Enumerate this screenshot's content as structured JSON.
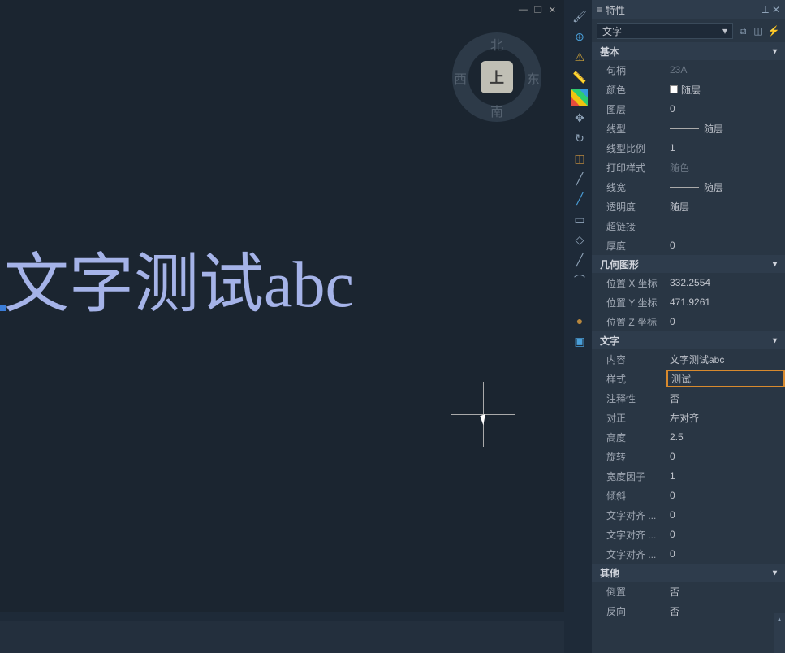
{
  "window_controls": {
    "min": "—",
    "restore": "❐",
    "close": "✕"
  },
  "compass": {
    "n": "北",
    "s": "南",
    "w": "西",
    "e": "东",
    "center": "上"
  },
  "canvas": {
    "text": "文字测试abc"
  },
  "panel": {
    "title": "特性",
    "pin": "⟂",
    "close": "✕",
    "selector_label": "文字"
  },
  "sections": {
    "basic": {
      "title": "基本",
      "handle_label": "句柄",
      "handle_value": "23A",
      "color_label": "颜色",
      "color_value": "随层",
      "layer_label": "图层",
      "layer_value": "0",
      "linetype_label": "线型",
      "linetype_value": "随层",
      "ltscale_label": "线型比例",
      "ltscale_value": "1",
      "plotstyle_label": "打印样式",
      "plotstyle_value": "随色",
      "lineweight_label": "线宽",
      "lineweight_value": "随层",
      "transparency_label": "透明度",
      "transparency_value": "随层",
      "hyperlink_label": "超链接",
      "hyperlink_value": "",
      "thickness_label": "厚度",
      "thickness_value": "0"
    },
    "geom": {
      "title": "几何图形",
      "posx_label": "位置 X 坐标",
      "posx_value": "332.2554",
      "posy_label": "位置 Y 坐标",
      "posy_value": "471.9261",
      "posz_label": "位置 Z 坐标",
      "posz_value": "0"
    },
    "text": {
      "title": "文字",
      "content_label": "内容",
      "content_value": "文字测试abc",
      "style_label": "样式",
      "style_value": "测试",
      "annotative_label": "注释性",
      "annotative_value": "否",
      "justify_label": "对正",
      "justify_value": "左对齐",
      "height_label": "高度",
      "height_value": "2.5",
      "rotation_label": "旋转",
      "rotation_value": "0",
      "widthfactor_label": "宽度因子",
      "widthfactor_value": "1",
      "oblique_label": "倾斜",
      "oblique_value": "0",
      "alignx_label": "文字对齐 ...",
      "alignx_value": "0",
      "aligny_label": "文字对齐 ...",
      "aligny_value": "0",
      "alignz_label": "文字对齐 ...",
      "alignz_value": "0"
    },
    "other": {
      "title": "其他",
      "backward_label": "倒置",
      "backward_value": "否",
      "upsidedown_label": "反向",
      "upsidedown_value": "否"
    }
  }
}
